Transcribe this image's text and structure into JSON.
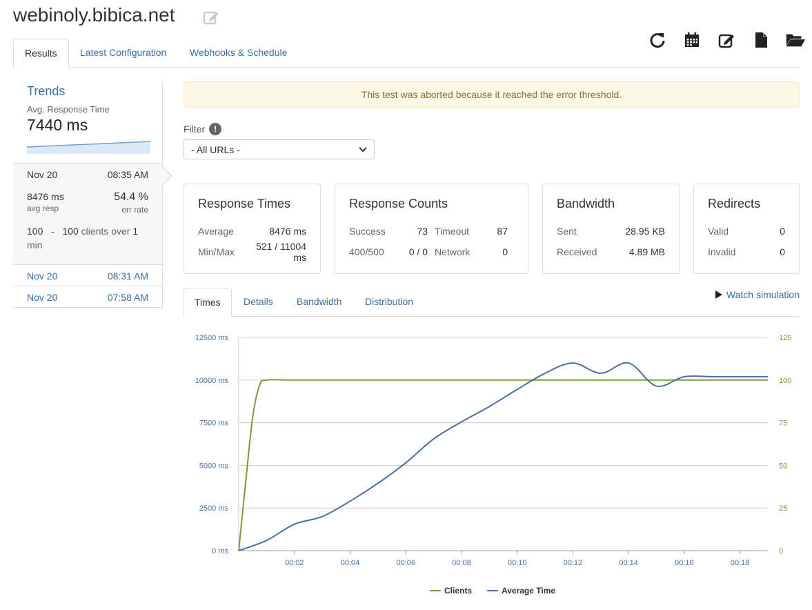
{
  "header": {
    "title": "webinoly.bibica.net"
  },
  "toolbar": {
    "icons": [
      "refresh-icon",
      "calendar-icon",
      "edit-icon",
      "file-icon",
      "folder-open-icon"
    ]
  },
  "tabs": [
    {
      "label": "Results",
      "active": true
    },
    {
      "label": "Latest Configuration",
      "active": false
    },
    {
      "label": "Webhooks & Schedule",
      "active": false
    }
  ],
  "sidebar": {
    "trends_title": "Trends",
    "trends_sub": "Avg. Response Time",
    "trends_value": "7440 ms",
    "active_run": {
      "date": "Nov 20",
      "time": "08:35 AM",
      "avg_resp": "8476 ms",
      "avg_resp_caption": "avg resp",
      "err_rate": "54.4 %",
      "err_rate_caption": "err rate",
      "clients_from": "100",
      "dash": "-",
      "clients_to": "100",
      "clients_text": "clients over",
      "duration": "1",
      "duration_unit": "min"
    },
    "runs": [
      {
        "date": "Nov 20",
        "time": "08:31 AM"
      },
      {
        "date": "Nov 20",
        "time": "07:58 AM"
      }
    ]
  },
  "alert": {
    "text": "This test was aborted because it reached the error threshold."
  },
  "filter": {
    "label": "Filter",
    "info_glyph": "!",
    "selected": "- All URLs -"
  },
  "cards": {
    "response_times": {
      "title": "Response Times",
      "average_label": "Average",
      "average_value": "8476 ms",
      "minmax_label": "Min/Max",
      "minmax_value": "521 / 11004 ms"
    },
    "response_counts": {
      "title": "Response Counts",
      "success_label": "Success",
      "success_value": "73",
      "timeout_label": "Timeout",
      "timeout_value": "87",
      "status_label": "400/500",
      "status_value": "0 / 0",
      "network_label": "Network",
      "network_value": "0"
    },
    "bandwidth": {
      "title": "Bandwidth",
      "sent_label": "Sent",
      "sent_value": "28.95 KB",
      "received_label": "Received",
      "received_value": "4.89 MB"
    },
    "redirects": {
      "title": "Redirects",
      "valid_label": "Valid",
      "valid_value": "0",
      "invalid_label": "Invalid",
      "invalid_value": "0"
    }
  },
  "subtabs": [
    {
      "label": "Times",
      "active": true
    },
    {
      "label": "Details",
      "active": false
    },
    {
      "label": "Bandwidth",
      "active": false
    },
    {
      "label": "Distribution",
      "active": false
    }
  ],
  "watch_simulation": "Watch simulation",
  "chart_data": {
    "type": "line",
    "x_ticks": [
      "00:02",
      "00:04",
      "00:06",
      "00:08",
      "00:10",
      "00:12",
      "00:14",
      "00:16",
      "00:18"
    ],
    "y_left_ticks": [
      "0 ms",
      "2500 ms",
      "5000 ms",
      "7500 ms",
      "10000 ms",
      "12500 ms"
    ],
    "y_right_ticks": [
      "0",
      "25",
      "50",
      "75",
      "100",
      "125"
    ],
    "ylim_left": [
      0,
      12500
    ],
    "ylim_right": [
      0,
      125
    ],
    "xlim_seconds": [
      0,
      19
    ],
    "grid": true,
    "legend_position": "bottom",
    "series": [
      {
        "name": "Clients",
        "axis": "right",
        "color": "#7a9a3d",
        "points": [
          [
            0,
            0
          ],
          [
            0.25,
            40
          ],
          [
            0.5,
            78
          ],
          [
            0.75,
            97
          ],
          [
            1,
            100
          ],
          [
            2,
            100
          ],
          [
            4,
            100
          ],
          [
            6,
            100
          ],
          [
            8,
            100
          ],
          [
            10,
            100
          ],
          [
            12,
            100
          ],
          [
            14,
            100
          ],
          [
            16,
            100
          ],
          [
            18,
            100
          ],
          [
            19,
            100
          ]
        ]
      },
      {
        "name": "Average Time",
        "axis": "left",
        "color": "#4a6fa0",
        "points": [
          [
            0,
            0
          ],
          [
            1,
            600
          ],
          [
            2,
            1550
          ],
          [
            3,
            2000
          ],
          [
            4,
            2900
          ],
          [
            5,
            3950
          ],
          [
            6,
            5150
          ],
          [
            7,
            6550
          ],
          [
            8,
            7550
          ],
          [
            9,
            8450
          ],
          [
            10,
            9450
          ],
          [
            11,
            10400
          ],
          [
            12,
            11000
          ],
          [
            13,
            10400
          ],
          [
            14,
            11000
          ],
          [
            15,
            9650
          ],
          [
            16,
            10200
          ],
          [
            17,
            10200
          ],
          [
            18,
            10200
          ],
          [
            19,
            10200
          ]
        ]
      }
    ]
  }
}
